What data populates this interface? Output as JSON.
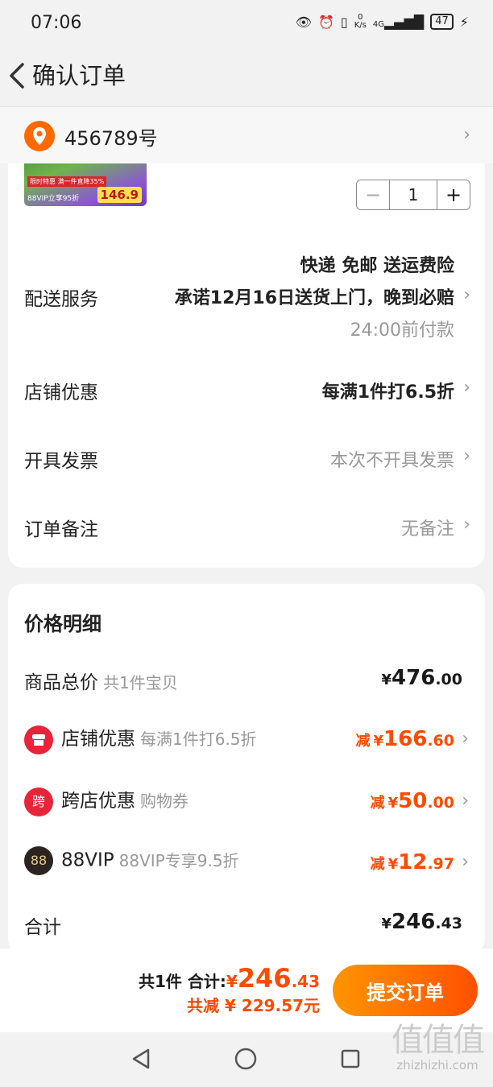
{
  "status_bar": {
    "time": "07:06",
    "net_speed_top": "0",
    "net_speed_unit": "K/s",
    "signal": "4G",
    "battery": "47"
  },
  "header": {
    "title": "确认订单"
  },
  "address": {
    "text": "456789号"
  },
  "product": {
    "thumb_price": "146.9",
    "thumb_sale_text": "限时特惠 满一件直降35%",
    "thumb_vip_text": "88VIP立享95折",
    "quantity": "1",
    "minus": "−",
    "plus": "+"
  },
  "delivery": {
    "label": "配送服务",
    "line1": "快递 免邮 送运费险",
    "line2": "承诺12月16日送货上门，晚到必赔",
    "line3": "24:00前付款"
  },
  "store_discount": {
    "label": "店铺优惠",
    "value": "每满1件打6.5折"
  },
  "invoice": {
    "label": "开具发票",
    "value": "本次不开具发票"
  },
  "note": {
    "label": "订单备注",
    "value": "无备注"
  },
  "price_detail": {
    "title": "价格明细",
    "currency": "¥",
    "reduce_label": "减",
    "goods_total": {
      "label": "商品总价",
      "sub": "共1件宝贝",
      "int": "476",
      "dec": ".00"
    },
    "store": {
      "label": "店铺优惠",
      "sub": "每满1件打6.5折",
      "int": "166",
      "dec": ".60"
    },
    "cross_store": {
      "icon_text": "跨",
      "label": "跨店优惠",
      "sub": "购物券",
      "int": "50",
      "dec": ".00"
    },
    "vip": {
      "icon_text": "88",
      "label": "88VIP",
      "sub": "88VIP专享9.5折",
      "int": "12",
      "dec": ".97"
    },
    "total": {
      "label": "合计",
      "int": "246",
      "dec": ".43"
    }
  },
  "bottom_bar": {
    "count_text": "共1件 合计:",
    "currency": "¥",
    "total_int": "246",
    "total_dec": ".43",
    "saved_text": "共减 ¥ 229.57元",
    "submit_label": "提交订单"
  },
  "watermark": {
    "big": "值值值",
    "small": "zhizhizhi.com"
  },
  "colors": {
    "accent": "#ff4a00",
    "button_start": "#ff9500",
    "button_end": "#ff5000",
    "pin": "#ff6a00"
  }
}
